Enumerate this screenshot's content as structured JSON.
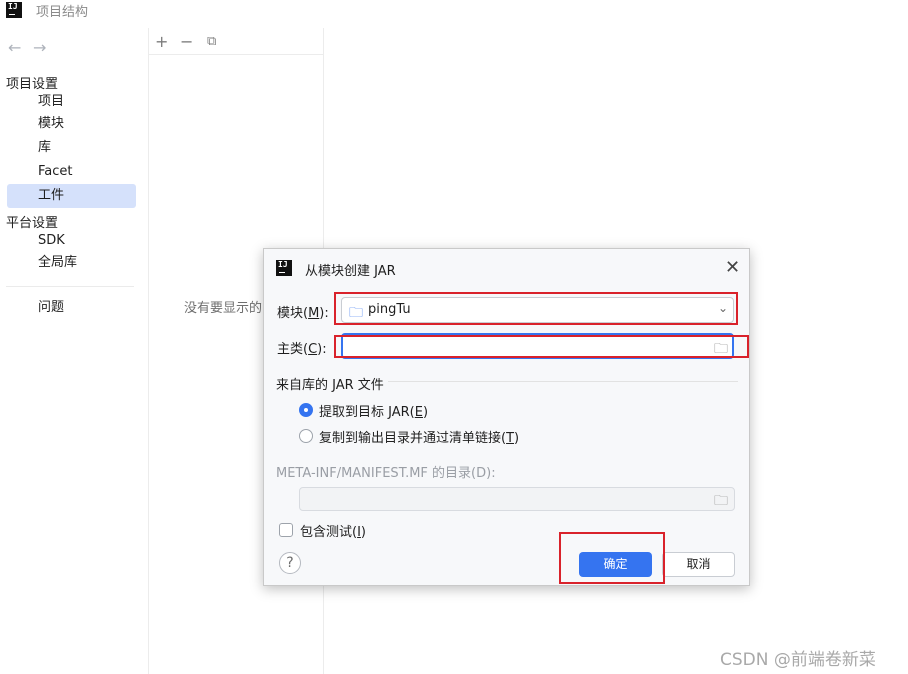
{
  "window": {
    "title": "项目结构",
    "logo_text": "IJ"
  },
  "sidebar": {
    "back_icon": "←",
    "forward_icon": "→",
    "project_settings_title": "项目设置",
    "project_items": [
      "项目",
      "模块",
      "库",
      "Facet",
      "工件"
    ],
    "selected_index": 4,
    "platform_settings_title": "平台设置",
    "platform_items": [
      "SDK",
      "全局库"
    ],
    "problems": "问题"
  },
  "middle": {
    "add_icon": "+",
    "remove_icon": "−",
    "copy_icon": "⧉",
    "empty_text": "没有要显示的"
  },
  "dialog": {
    "logo_text": "IJ",
    "title": "从模块创建 JAR",
    "close_icon": "✕",
    "module_label_pre": "模块(",
    "module_label_key": "M",
    "module_label_post": "):",
    "module_value": "pingTu",
    "main_class_label_pre": "主类(",
    "main_class_label_key": "C",
    "main_class_label_post": "):",
    "main_class_value": "",
    "jar_group_label": "来自库的 JAR 文件",
    "radio_extract_pre": "提取到目标 JAR(",
    "radio_extract_key": "E",
    "radio_extract_post": ")",
    "radio_copy_pre": "复制到输出目录并通过清单链接(",
    "radio_copy_key": "T",
    "radio_copy_post": ")",
    "selected_radio": "extract",
    "manifest_label": "META-INF/MANIFEST.MF 的目录(D):",
    "manifest_value": "",
    "include_tests_pre": "包含测试(",
    "include_tests_key": "I",
    "include_tests_post": ")",
    "include_tests_checked": false,
    "help_icon": "?",
    "ok_label": "确定",
    "cancel_label": "取消"
  },
  "watermark": "CSDN @前端卷新菜",
  "colors": {
    "accent": "#3574f0",
    "selection": "#d5e1fb",
    "annotation_red": "#d9222b"
  }
}
